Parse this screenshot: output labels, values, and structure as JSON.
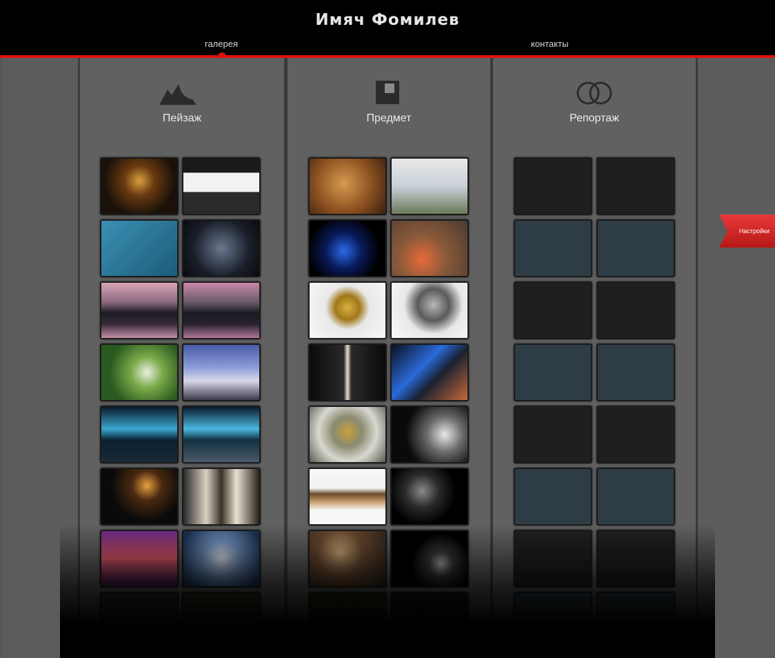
{
  "header": {
    "title": "Имяч Фомилев",
    "nav": {
      "gallery": "галерея",
      "contacts": "контакты"
    }
  },
  "columns": {
    "landscape": {
      "title": "Пейзаж",
      "icon": "mountain-icon"
    },
    "subject": {
      "title": "Предмет",
      "icon": "square-icon"
    },
    "report": {
      "title": "Репортаж",
      "icon": "rings-icon"
    }
  },
  "settings": {
    "label": "Настройки"
  },
  "colors": {
    "accent": "#e01010",
    "background": "#5c5c5c",
    "header": "#000000"
  }
}
